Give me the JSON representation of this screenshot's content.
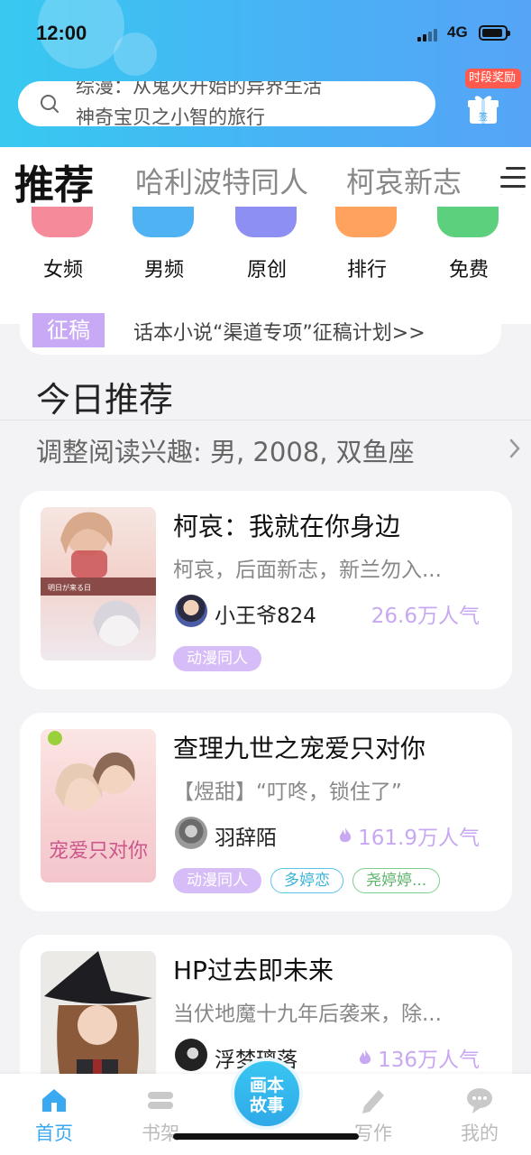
{
  "status_bar": {
    "time": "12:00",
    "network": "4G"
  },
  "search": {
    "line1": "综漫：从鬼灭开始的异界生活",
    "line2": "神奇宝贝之小智的旅行"
  },
  "reward": {
    "tag": "时段奖励",
    "box_label": "签"
  },
  "tabs": [
    "推荐",
    "哈利波特同人",
    "柯哀新志",
    "其他"
  ],
  "categories": [
    {
      "label": "女频",
      "color": "#f58a9b"
    },
    {
      "label": "男频",
      "color": "#4fb3f3"
    },
    {
      "label": "原创",
      "color": "#8d8ff2"
    },
    {
      "label": "排行",
      "color": "#ffa25e"
    },
    {
      "label": "免费",
      "color": "#5cd07c"
    }
  ],
  "notice": {
    "tag": "征稿",
    "text": "话本小说“渠道专项”征稿计划>>"
  },
  "today": {
    "title": "今日推荐",
    "interest": "调整阅读兴趣: 男, 2008, 双鱼座"
  },
  "books": [
    {
      "title": "柯哀：我就在你身边",
      "desc": "柯哀，后面新志，新兰勿入...",
      "author": "小王爷824",
      "popularity": "26.6万人气",
      "hot": false,
      "tags": [
        {
          "label": "动漫同人",
          "style": "purple"
        }
      ],
      "cover_text": "明日が来る日"
    },
    {
      "title": "查理九世之宠爱只对你",
      "desc": "【煜甜】“叮咚，锁住了”",
      "author": "羽辞陌",
      "popularity": "161.9万人气",
      "hot": true,
      "tags": [
        {
          "label": "动漫同人",
          "style": "purple"
        },
        {
          "label": "多婷恋",
          "style": "cyan"
        },
        {
          "label": "尧婷婷...",
          "style": "green"
        }
      ],
      "cover_text": "宠爱只对你"
    },
    {
      "title": "HP过去即未来",
      "desc": "当伏地魔十九年后袭来，除...",
      "author": "浮梦璃落",
      "popularity": "136万人气",
      "hot": true,
      "tags": [],
      "cover_text": ""
    }
  ],
  "bottom_nav": {
    "items": [
      "首页",
      "书架",
      "写作",
      "我的"
    ],
    "center": [
      "画本",
      "故事"
    ]
  }
}
